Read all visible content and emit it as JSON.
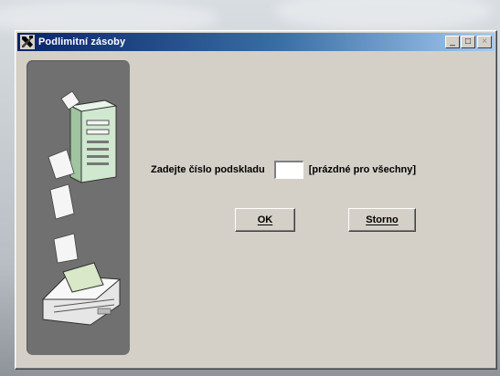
{
  "window": {
    "title": "Podlimitní zásoby",
    "app_icon": "tools-icon",
    "controls": {
      "minimize": "_",
      "maximize": "□",
      "close": "×"
    }
  },
  "form": {
    "prompt_label": "Zadejte číslo podskladu",
    "warehouse_input_value": "",
    "hint": "[prázdné pro všechny]"
  },
  "buttons": {
    "ok": "OK",
    "cancel": "Storno"
  },
  "illustration": {
    "icon": "computer-printer-papers-icon"
  },
  "colors": {
    "title_start": "#0a246a",
    "title_end": "#a6caf0",
    "window_bg": "#d4d0c8",
    "side_panel": "#707070"
  }
}
